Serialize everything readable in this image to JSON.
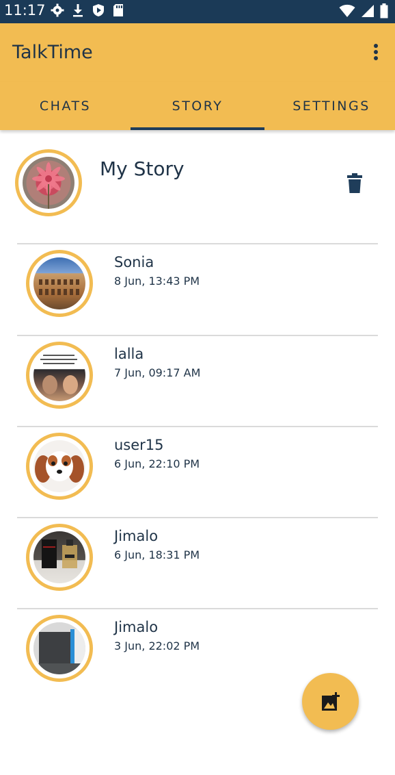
{
  "status_bar": {
    "time": "11:17",
    "left_icons": [
      "settings-icon",
      "download-icon",
      "shield-icon",
      "sd-card-icon"
    ],
    "right_icons": [
      "wifi-icon",
      "signal-icon",
      "battery-icon"
    ]
  },
  "app_bar": {
    "title": "TalkTime",
    "overflow_icon": "more-vert-icon"
  },
  "tabs": [
    {
      "label": "CHATS",
      "selected": false
    },
    {
      "label": "STORY",
      "selected": true
    },
    {
      "label": "SETTINGS",
      "selected": false
    }
  ],
  "my_story": {
    "label": "My Story",
    "delete_icon": "trash-icon"
  },
  "stories": [
    {
      "name": "Sonia",
      "time": "8 Jun, 13:43 PM"
    },
    {
      "name": "lalla",
      "time": "7 Jun, 09:17 AM"
    },
    {
      "name": "user15",
      "time": "6 Jun, 22:10 PM"
    },
    {
      "name": "Jimalo",
      "time": "6 Jun, 18:31 PM"
    },
    {
      "name": "Jimalo",
      "time": "3 Jun, 22:02 PM"
    }
  ],
  "fab": {
    "icon": "add-photo-icon"
  },
  "colors": {
    "accent": "#f2bc52",
    "primary_dark": "#1b3a57",
    "text": "#1f3347",
    "divider": "#dadada"
  }
}
